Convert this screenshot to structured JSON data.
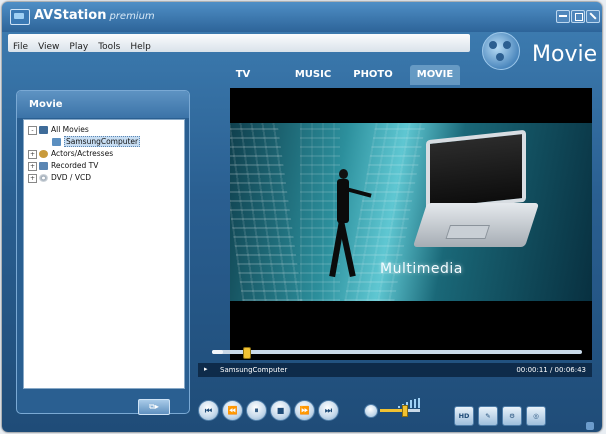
{
  "window": {
    "title": "AVStation",
    "title_suffix": "premium"
  },
  "menu": [
    "File",
    "View",
    "Play",
    "Tools",
    "Help"
  ],
  "brand": {
    "mode_title": "Movie"
  },
  "tabs": [
    {
      "label": "TV",
      "active": false
    },
    {
      "label": "MUSIC",
      "active": false
    },
    {
      "label": "PHOTO",
      "active": false
    },
    {
      "label": "MOVIE",
      "active": true
    }
  ],
  "left_panel": {
    "title": "Movie",
    "tree": [
      {
        "label": "All Movies",
        "expander": "-",
        "icon": "film-icon",
        "selected": false
      },
      {
        "label": "SamsungComputer",
        "expander": "",
        "icon": "movie-file-icon",
        "selected": true
      },
      {
        "label": "Actors/Actresses",
        "expander": "+",
        "icon": "people-icon",
        "selected": false
      },
      {
        "label": "Recorded TV",
        "expander": "+",
        "icon": "tv-icon",
        "selected": false
      },
      {
        "label": "DVD / VCD",
        "expander": "+",
        "icon": "disc-icon",
        "selected": false
      }
    ],
    "action_button_icon": "add-to-playlist-icon"
  },
  "video": {
    "overlay_text": "Multimedia"
  },
  "playback": {
    "progress": 0.03,
    "now_playing": "SamsungComputer",
    "current_time": "00:00:11",
    "total_time": "00:06:43",
    "time_display": "00:00:11 / 00:06:43"
  },
  "transport_icons": [
    "skip-back-icon",
    "rewind-icon",
    "pause-icon",
    "stop-icon",
    "fast-forward-icon",
    "skip-forward-icon"
  ],
  "volume": {
    "level": 0.6
  },
  "side_buttons": [
    "hd-icon",
    "edit-icon",
    "settings-icon",
    "capture-icon"
  ],
  "colors": {
    "accent": "#2a5f91",
    "highlight": "#f1c232"
  }
}
